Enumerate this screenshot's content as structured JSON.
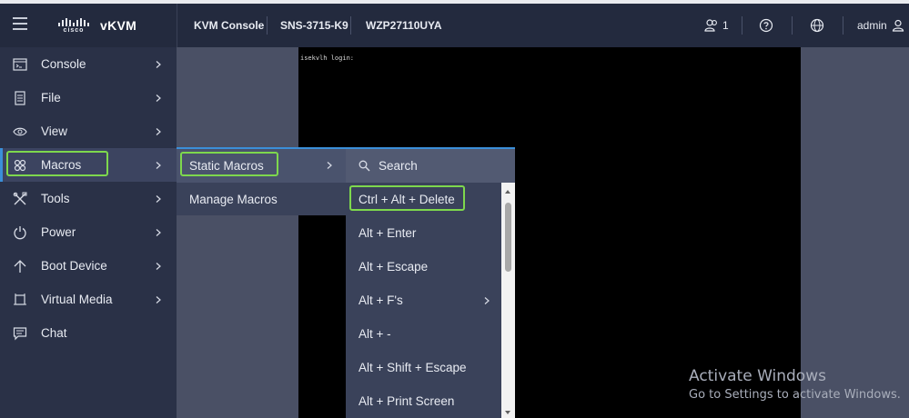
{
  "header": {
    "brand_logo_text": "cisco",
    "app_title": "vKVM",
    "tabs": [
      "KVM Console",
      "SNS-3715-K9",
      "WZP27110UYA"
    ],
    "user_count": "1",
    "username": "admin"
  },
  "sidebar": {
    "items": [
      {
        "label": "Console",
        "icon": "console-icon"
      },
      {
        "label": "File",
        "icon": "file-icon"
      },
      {
        "label": "View",
        "icon": "eye-icon"
      },
      {
        "label": "Macros",
        "icon": "macros-icon"
      },
      {
        "label": "Tools",
        "icon": "tools-icon"
      },
      {
        "label": "Power",
        "icon": "power-icon"
      },
      {
        "label": "Boot Device",
        "icon": "boot-arrow-icon"
      },
      {
        "label": "Virtual Media",
        "icon": "virtual-media-icon"
      },
      {
        "label": "Chat",
        "icon": "chat-icon"
      }
    ],
    "active": "Macros"
  },
  "macros_submenu": {
    "items": [
      "Static Macros",
      "Manage Macros"
    ],
    "active": "Static Macros"
  },
  "static_macros": {
    "search_label": "Search",
    "items": [
      "Ctrl + Alt + Delete",
      "Alt + Enter",
      "Alt + Escape",
      "Alt + F's",
      "Alt + -",
      "Alt + Shift + Escape",
      "Alt + Print Screen"
    ]
  },
  "console": {
    "text": "isekvlh login:"
  },
  "watermark": {
    "title": "Activate Windows",
    "subtitle": "Go to Settings to activate Windows."
  },
  "colors": {
    "highlight": "#7ed84d",
    "accent": "#3b8fd9"
  }
}
